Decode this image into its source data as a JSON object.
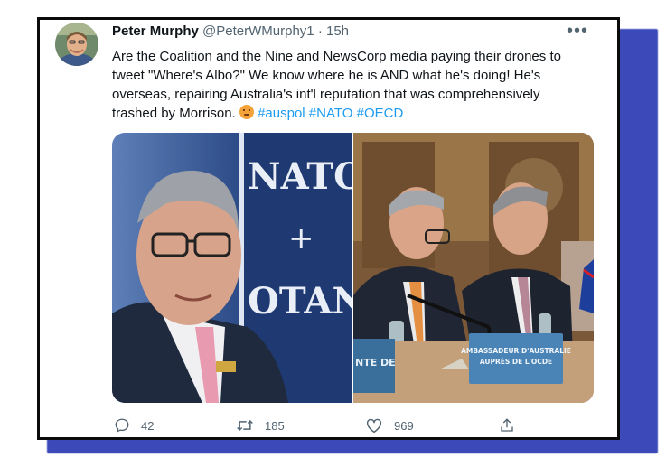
{
  "tweet": {
    "author_name": "Peter Murphy",
    "handle": "@PeterWMurphy1",
    "separator": "·",
    "time": "15h",
    "more_label": "•••",
    "text_lines": [
      "Are the Coalition and the Nine and NewsCorp media paying their drones to",
      "tweet \"Where's Albo?\" We know where he is AND what he's doing! He's",
      "overseas, repairing Australia's int'l reputation that was comprehensively",
      "trashed by Morrison."
    ],
    "emoji": "angry-face-emoji",
    "hashtags": [
      "#auspol",
      "#NATO",
      "#OECD"
    ]
  },
  "media": {
    "left_sign_top": "NATO",
    "left_sign_plus": "+",
    "left_sign_bottom": "OTAN",
    "right_placard_line1": "AMBASSADEUR D'AUSTRALIE",
    "right_placard_line2": "AUPRÈS DE L'OCDE",
    "right_side_placard": "NTE DE"
  },
  "actions": {
    "reply_count": "42",
    "retweet_count": "185",
    "like_count": "969"
  },
  "colors": {
    "frame_shadow": "#3c49b8",
    "hashtag": "#1d9bf0",
    "text_primary": "#0f1419",
    "text_secondary": "#536471"
  }
}
